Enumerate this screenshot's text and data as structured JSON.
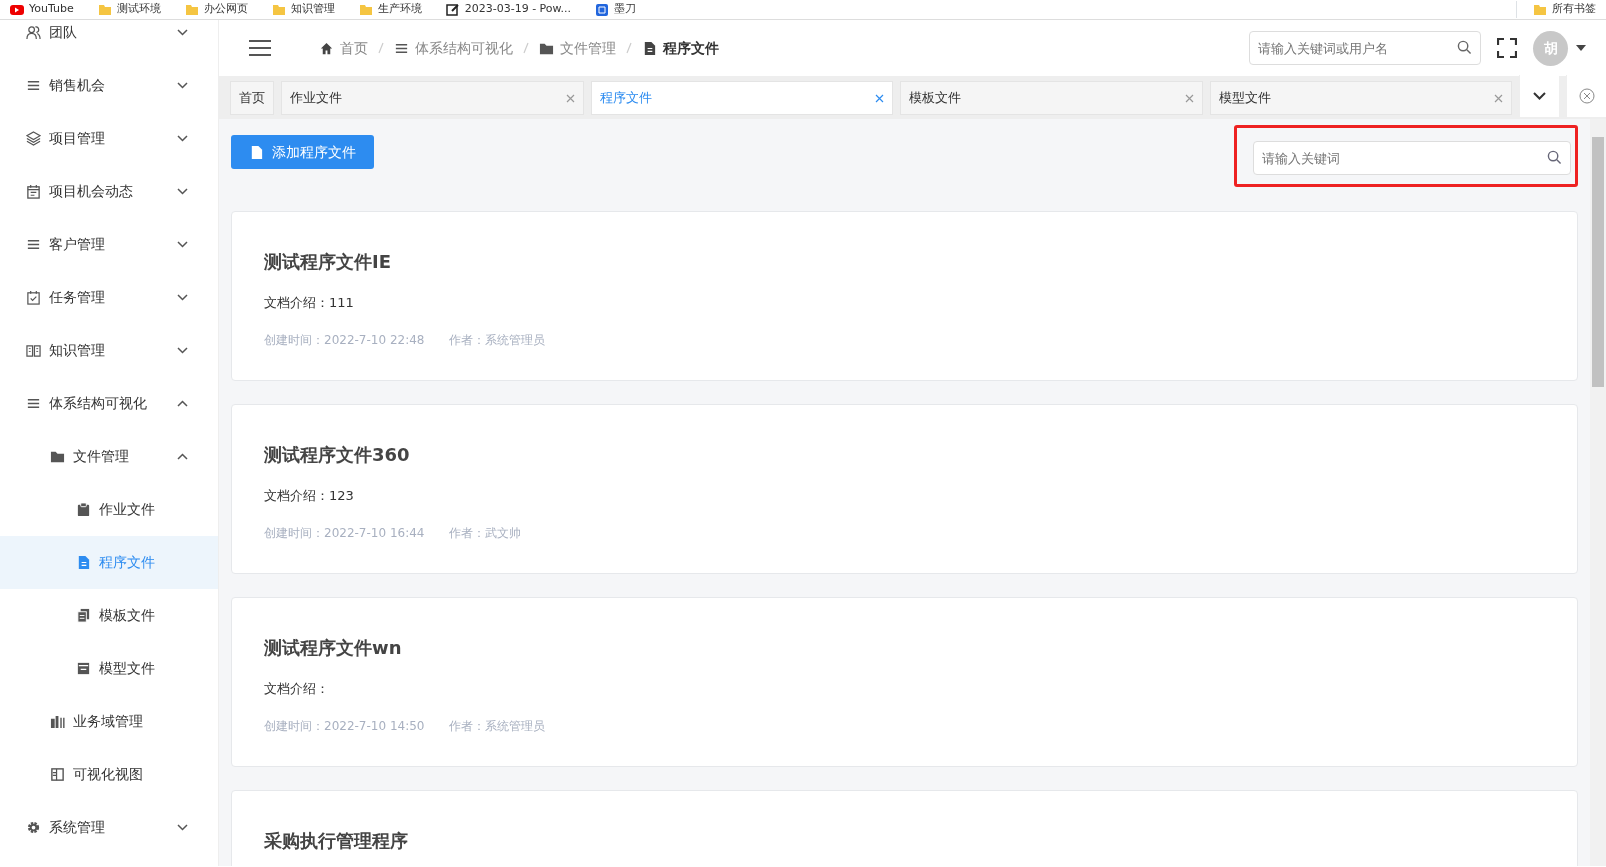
{
  "bookmarks": [
    {
      "label": "YouTube",
      "kind": "video"
    },
    {
      "label": "测试环境",
      "kind": "folder"
    },
    {
      "label": "办公网页",
      "kind": "folder"
    },
    {
      "label": "知识管理",
      "kind": "folder"
    },
    {
      "label": "生产环境",
      "kind": "folder"
    },
    {
      "label": "2023-03-19 - Pow...",
      "kind": "edit"
    },
    {
      "label": "墨刀",
      "kind": "app"
    }
  ],
  "all_bookmarks": {
    "label": "所有书签"
  },
  "sidebar": {
    "items": [
      {
        "label": "团队",
        "kind": "team",
        "expanded": false
      },
      {
        "label": "销售机会",
        "kind": "lines",
        "expanded": false
      },
      {
        "label": "项目管理",
        "kind": "layers",
        "expanded": false
      },
      {
        "label": "项目机会动态",
        "kind": "calendar",
        "expanded": false
      },
      {
        "label": "客户管理",
        "kind": "lines",
        "expanded": false
      },
      {
        "label": "任务管理",
        "kind": "task",
        "expanded": false
      },
      {
        "label": "知识管理",
        "kind": "book",
        "expanded": false
      },
      {
        "label": "体系结构可视化",
        "kind": "lines",
        "expanded": true,
        "children": [
          {
            "label": "文件管理",
            "kind": "folder",
            "expanded": true,
            "children": [
              {
                "label": "作业文件",
                "kind": "clipboard",
                "selected": false
              },
              {
                "label": "程序文件",
                "kind": "doc",
                "selected": true
              },
              {
                "label": "模板文件",
                "kind": "copy",
                "selected": false
              },
              {
                "label": "模型文件",
                "kind": "window",
                "selected": false
              }
            ]
          },
          {
            "label": "业务域管理",
            "kind": "bars",
            "selected": false
          },
          {
            "label": "可视化视图",
            "kind": "panel",
            "selected": false
          }
        ]
      },
      {
        "label": "系统管理",
        "kind": "gear",
        "expanded": false
      }
    ]
  },
  "breadcrumb": [
    {
      "label": "首页",
      "kind": "home",
      "current": false
    },
    {
      "label": "体系结构可视化",
      "kind": "lines",
      "current": false
    },
    {
      "label": "文件管理",
      "kind": "folder",
      "current": false
    },
    {
      "label": "程序文件",
      "kind": "doc",
      "current": true
    }
  ],
  "header_search": {
    "placeholder": "请输入关键词或用户名"
  },
  "avatar": {
    "label": "胡"
  },
  "tabs": [
    {
      "label": "首页",
      "selected": false,
      "closable": false
    },
    {
      "label": "作业文件",
      "selected": false,
      "closable": true
    },
    {
      "label": "程序文件",
      "selected": true,
      "closable": true
    },
    {
      "label": "模板文件",
      "selected": false,
      "closable": true
    },
    {
      "label": "模型文件",
      "selected": false,
      "closable": true
    }
  ],
  "add_button": {
    "label": "添加程序文件"
  },
  "search": {
    "placeholder": "请输入关键词"
  },
  "documents": [
    {
      "title": "测试程序文件IE",
      "intro": "文档介绍：111",
      "created": "创建时间：2022-7-10 22:48",
      "author": "作者：系统管理员"
    },
    {
      "title": "测试程序文件360",
      "intro": "文档介绍：123",
      "created": "创建时间：2022-7-10 16:44",
      "author": "作者：武文帅"
    },
    {
      "title": "测试程序文件wn",
      "intro": "文档介绍：",
      "created": "创建时间：2022-7-10 14:50",
      "author": "作者：系统管理员"
    },
    {
      "title": "采购执行管理程序"
    }
  ]
}
